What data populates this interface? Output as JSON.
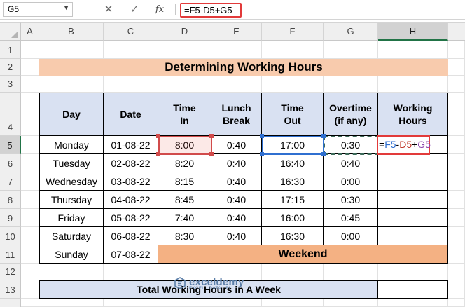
{
  "formula_bar": {
    "name_box": "G5",
    "cancel_icon": "cancel-x-icon",
    "enter_icon": "check-icon",
    "fx_label": "fx",
    "formula": "=F5-D5+G5"
  },
  "columns": [
    "A",
    "B",
    "C",
    "D",
    "E",
    "F",
    "G",
    "H"
  ],
  "rows": [
    "1",
    "2",
    "3",
    "4",
    "5",
    "6",
    "7",
    "8",
    "9",
    "10",
    "11",
    "12",
    "13"
  ],
  "title": "Determining Working Hours",
  "headers": {
    "day": "Day",
    "date": "Date",
    "time_in_1": "Time",
    "time_in_2": "In",
    "lunch_1": "Lunch",
    "lunch_2": "Break",
    "time_out_1": "Time",
    "time_out_2": "Out",
    "overtime_1": "Overtime",
    "overtime_2": "(if any)",
    "working_1": "Working",
    "working_2": "Hours"
  },
  "table": [
    {
      "day": "Monday",
      "date": "01-08-22",
      "time_in": "8:00",
      "lunch": "0:40",
      "time_out": "17:00",
      "overtime": "0:30"
    },
    {
      "day": "Tuesday",
      "date": "02-08-22",
      "time_in": "8:20",
      "lunch": "0:40",
      "time_out": "16:40",
      "overtime": "0:40"
    },
    {
      "day": "Wednesday",
      "date": "03-08-22",
      "time_in": "8:15",
      "lunch": "0:40",
      "time_out": "16:30",
      "overtime": "0:00"
    },
    {
      "day": "Thursday",
      "date": "04-08-22",
      "time_in": "8:45",
      "lunch": "0:40",
      "time_out": "17:15",
      "overtime": "0:30"
    },
    {
      "day": "Friday",
      "date": "05-08-22",
      "time_in": "7:40",
      "lunch": "0:40",
      "time_out": "16:00",
      "overtime": "0:45"
    },
    {
      "day": "Saturday",
      "date": "06-08-22",
      "time_in": "8:30",
      "lunch": "0:40",
      "time_out": "16:30",
      "overtime": "0:00"
    }
  ],
  "sunday": {
    "day": "Sunday",
    "date": "07-08-22",
    "label": "Weekend"
  },
  "editing_formula": {
    "eq": "=",
    "f5": "F5",
    "minus": "-",
    "d5": "D5",
    "plus": "+",
    "g5": "G5"
  },
  "total_label": "Total Working Hours in A Week",
  "watermark": {
    "name": "exceldemy",
    "tagline": "EXCEL · DATA · BI"
  },
  "colors": {
    "header_fill": "#d9e1f2",
    "title_fill": "#f8cbad",
    "weekend_fill": "#f4b183",
    "ref_red": "#c0392b",
    "ref_blue": "#2f6fd0",
    "ref_purple": "#8e44ad",
    "active_border": "#e23a3a"
  }
}
